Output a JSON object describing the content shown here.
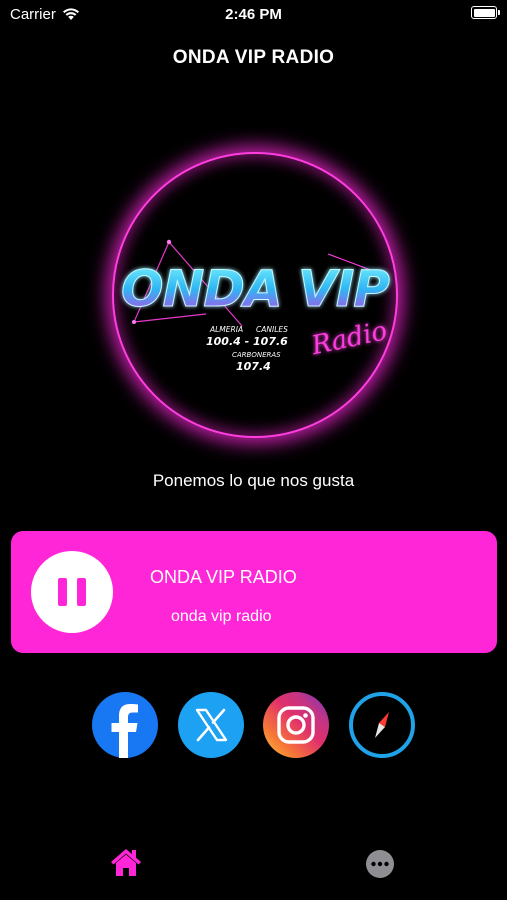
{
  "status_bar": {
    "carrier": "Carrier",
    "time": "2:46 PM"
  },
  "header": {
    "title": "ONDA VIP RADIO"
  },
  "logo": {
    "brand": "ONDA VIP",
    "script": "Radio",
    "stations": [
      "ALMERIA",
      "CANILES",
      "100.4 - 107.6",
      "CARBONERAS",
      "107.4"
    ]
  },
  "tagline": "Ponemos lo que nos gusta",
  "player": {
    "title": "ONDA VIP RADIO",
    "subtitle": "onda vip radio",
    "state": "playing"
  },
  "social": [
    {
      "icon": "facebook-icon"
    },
    {
      "icon": "x-twitter-icon"
    },
    {
      "icon": "instagram-icon"
    },
    {
      "icon": "safari-compass-icon"
    }
  ],
  "tabs": [
    {
      "icon": "home-icon",
      "selected": true
    },
    {
      "icon": "more-icon",
      "selected": false
    }
  ],
  "colors": {
    "accent": "#ff26d8",
    "background": "#000000",
    "facebook": "#1877f2",
    "twitter": "#1da1f2",
    "safari": "#1fa2e8"
  }
}
